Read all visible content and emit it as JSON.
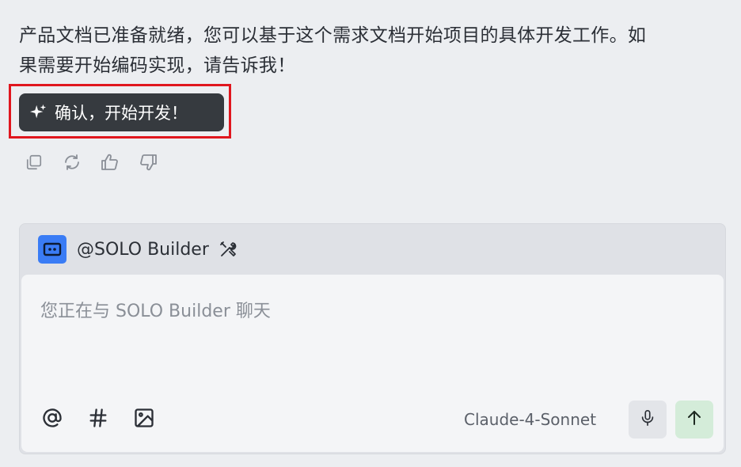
{
  "message": {
    "line1": "产品文档已准备就绪，您可以基于这个需求文档开始项目的具体开发工作。如",
    "line2": "果需要开始编码实现，请告诉我！"
  },
  "confirm_button": {
    "label": "确认，开始开发！",
    "icon": "sparkle-icon"
  },
  "message_actions": [
    "copy-icon",
    "regenerate-icon",
    "thumbs-up-icon",
    "thumbs-down-icon"
  ],
  "composer": {
    "agent_name": "@SOLO Builder",
    "agent_icon": "robot-icon",
    "tools_icon": "tools-icon",
    "placeholder": "您正在与 SOLO Builder 聊天",
    "toolbar": [
      "at-mention-icon",
      "hashtag-icon",
      "image-icon"
    ],
    "model": "Claude-4-Sonnet",
    "mic_icon": "microphone-icon",
    "send_icon": "send-arrow-icon"
  },
  "colors": {
    "highlight_border": "#e0161e",
    "button_bg": "#363a3f",
    "agent_icon_bg": "#3a7cf5",
    "send_bg": "#d4ecd9"
  }
}
